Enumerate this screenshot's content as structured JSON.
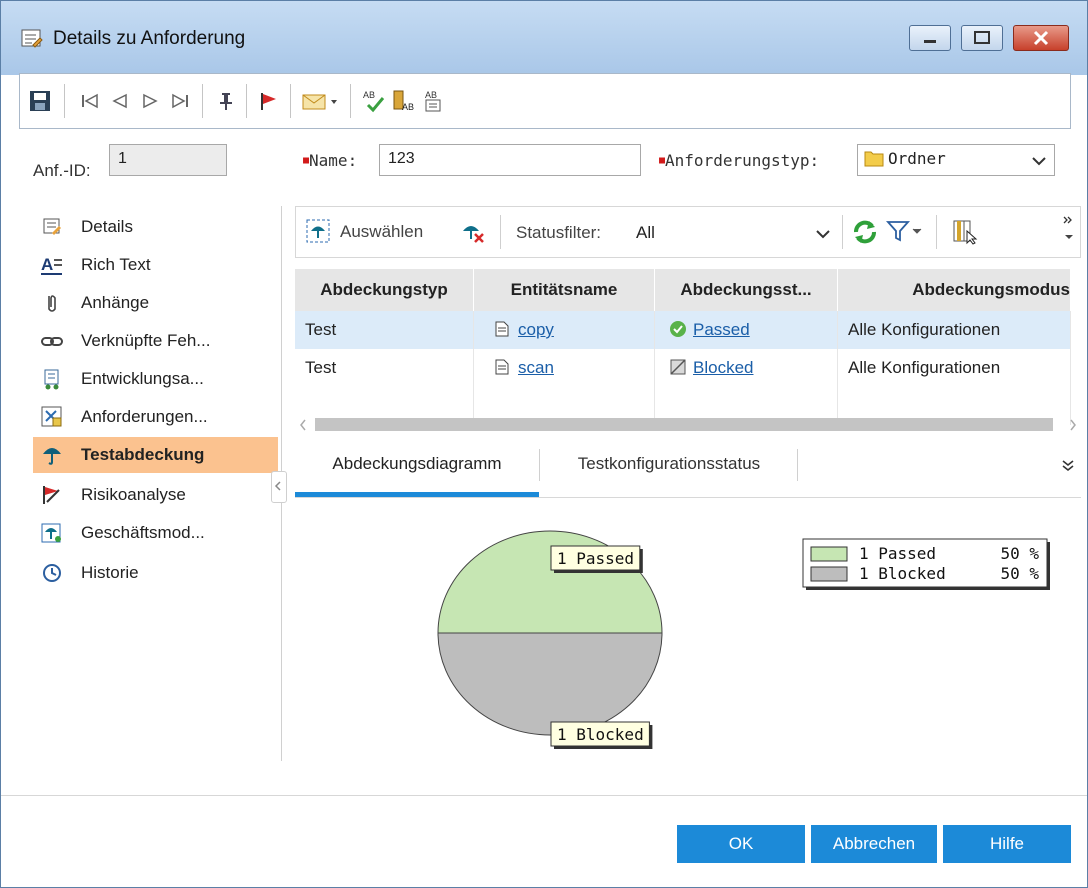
{
  "window": {
    "title": "Details zu Anforderung"
  },
  "fields": {
    "id_label": "Anf.-ID:",
    "id_value": "1",
    "name_label": "Name:",
    "name_value": "123",
    "type_label": "Anforderungstyp:",
    "type_value": "Ordner"
  },
  "nav": {
    "items": [
      {
        "label": "Details",
        "icon": "details-icon"
      },
      {
        "label": "Rich Text",
        "icon": "rich-text-icon"
      },
      {
        "label": "Anhänge",
        "icon": "paperclip-icon"
      },
      {
        "label": "Verknüpfte Feh...",
        "icon": "link-icon"
      },
      {
        "label": "Entwicklungsa...",
        "icon": "development-icon"
      },
      {
        "label": "Anforderungen...",
        "icon": "requirements-icon"
      },
      {
        "label": "Testabdeckung",
        "icon": "umbrella-icon"
      },
      {
        "label": "Risikoanalyse",
        "icon": "risk-icon"
      },
      {
        "label": "Geschäftsmod...",
        "icon": "business-model-icon"
      },
      {
        "label": "Historie",
        "icon": "history-icon"
      }
    ],
    "active": "Testabdeckung"
  },
  "grid_toolbar": {
    "select_label": "Auswählen",
    "status_filter_label": "Statusfilter:",
    "status_filter_value": "All"
  },
  "grid": {
    "columns": [
      "Abdeckungstyp",
      "Entitätsname",
      "Abdeckungsst...",
      "Abdeckungsmodus"
    ],
    "rows": [
      {
        "type": "Test",
        "entity": "copy",
        "status": "Passed",
        "mode": "Alle Konfigurationen"
      },
      {
        "type": "Test",
        "entity": "scan",
        "status": "Blocked",
        "mode": "Alle Konfigurationen"
      }
    ]
  },
  "tabs": [
    "Abdeckungsdiagramm",
    "Testkonfigurationsstatus"
  ],
  "chart_data": {
    "type": "pie",
    "categories": [
      "Passed",
      "Blocked"
    ],
    "values": [
      1,
      1
    ],
    "slice_labels": [
      "1 Passed",
      "1 Blocked"
    ],
    "legend": [
      {
        "label": "1 Passed",
        "percent": "50 %"
      },
      {
        "label": "1 Blocked",
        "percent": "50 %"
      }
    ],
    "colors": [
      "#c6e6b3",
      "#bdbdbd"
    ],
    "legend_position": "top-right"
  },
  "buttons": {
    "ok": "OK",
    "cancel": "Abbrechen",
    "help": "Hilfe"
  }
}
